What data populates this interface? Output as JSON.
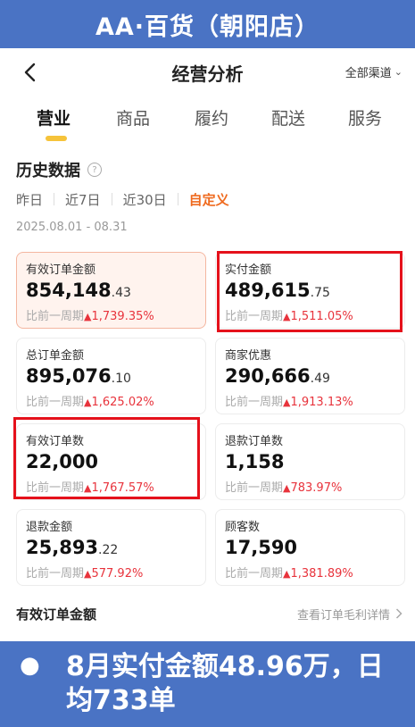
{
  "banner": {
    "title": "AA·百货（朝阳店）"
  },
  "header": {
    "title": "经营分析",
    "channel": "全部渠道",
    "back_icon": "chevron-left-icon"
  },
  "tabs": [
    {
      "label": "营业",
      "active": true
    },
    {
      "label": "商品",
      "active": false
    },
    {
      "label": "履约",
      "active": false
    },
    {
      "label": "配送",
      "active": false
    },
    {
      "label": "服务",
      "active": false
    }
  ],
  "section": {
    "title": "历史数据",
    "help_icon": "question-circle-icon"
  },
  "ranges": [
    {
      "label": "昨日",
      "active": false
    },
    {
      "label": "近7日",
      "active": false
    },
    {
      "label": "近30日",
      "active": false
    },
    {
      "label": "自定义",
      "active": true
    }
  ],
  "date_range": "2025.08.01 - 08.31",
  "compare_label": "比前一周期",
  "metrics": [
    {
      "label": "有效订单金额",
      "int": "854,148",
      "dec": ".43",
      "pct": "1,739.35%"
    },
    {
      "label": "实付金额",
      "int": "489,615",
      "dec": ".75",
      "pct": "1,511.05%"
    },
    {
      "label": "总订单金额",
      "int": "895,076",
      "dec": ".10",
      "pct": "1,625.02%"
    },
    {
      "label": "商家优惠",
      "int": "290,666",
      "dec": ".49",
      "pct": "1,913.13%"
    },
    {
      "label": "有效订单数",
      "int": "22,000",
      "dec": "",
      "pct": "1,767.57%"
    },
    {
      "label": "退款订单数",
      "int": "1,158",
      "dec": "",
      "pct": "783.97%"
    },
    {
      "label": "退款金额",
      "int": "25,893",
      "dec": ".22",
      "pct": "577.92%"
    },
    {
      "label": "顾客数",
      "int": "17,590",
      "dec": "",
      "pct": "1,381.89%"
    }
  ],
  "bottom": {
    "title": "有效订单金额",
    "link": "查看订单毛利详情"
  },
  "caption": {
    "text": "8月实付金额48.96万，日均733单"
  },
  "colors": {
    "banner_bg": "#4a73c4",
    "accent_orange": "#ef6a1e",
    "increase_red": "#e8333c",
    "highlight_box": "#e5111b",
    "tab_indicator": "#f6c33a"
  }
}
